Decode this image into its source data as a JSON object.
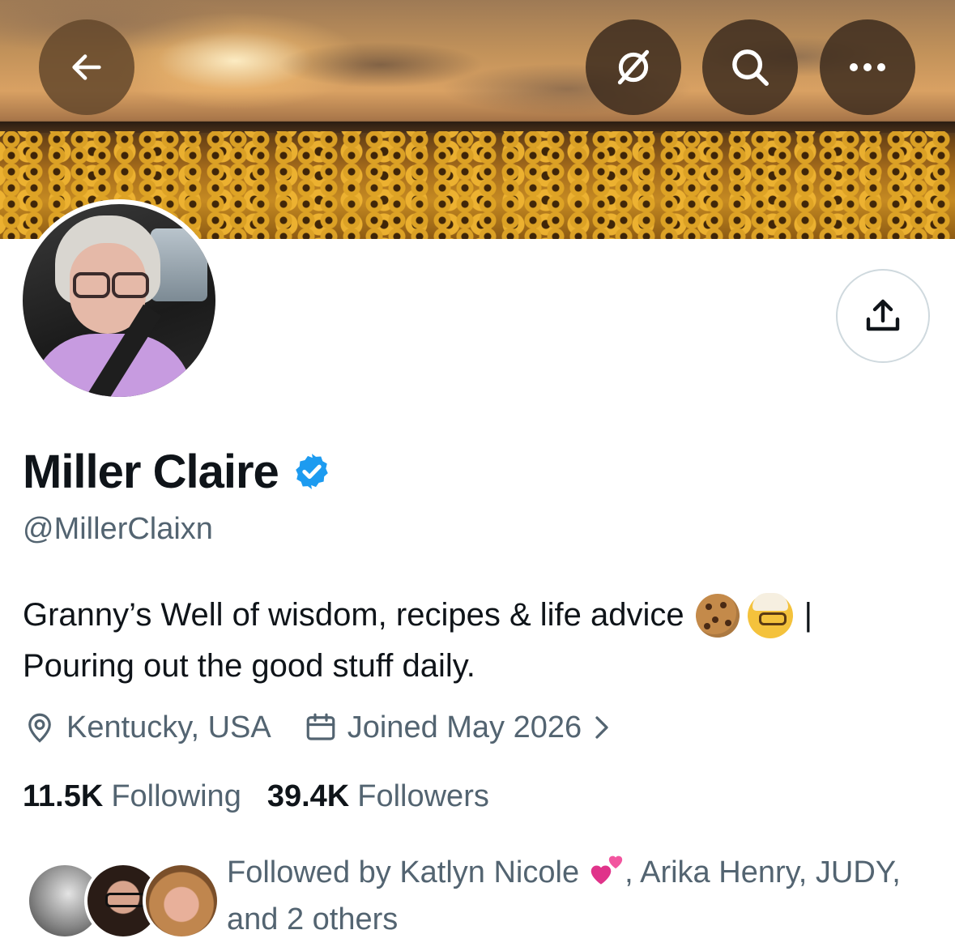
{
  "header": {
    "back_icon": "arrow-left-icon",
    "grok_icon": "grok-icon",
    "search_icon": "search-icon",
    "more_icon": "more-horizontal-icon"
  },
  "profile": {
    "name": "Miller Claire",
    "verified": true,
    "handle": "@MillerClaixn",
    "bio_line1": "Granny’s Well of wisdom, recipes & life advice",
    "bio_line1_suffix": "|",
    "bio_line2": "Pouring out the good stuff daily.",
    "bio_emojis": [
      "cookie-emoji",
      "old-woman-emoji"
    ],
    "location": "Kentucky, USA",
    "joined": "Joined May 2026"
  },
  "stats": {
    "following_count": "11.5K",
    "following_label": "Following",
    "followers_count": "39.4K",
    "followers_label": "Followers"
  },
  "followed_by": {
    "prefix": "Followed by Katlyn Nicole",
    "suffix": ", Arika Henry, JUDY,",
    "line2": "and 2 others"
  },
  "colors": {
    "primary_text": "#0f1419",
    "secondary_text": "#536471",
    "verified_blue": "#1d9bf0",
    "border": "#cfd9de"
  }
}
